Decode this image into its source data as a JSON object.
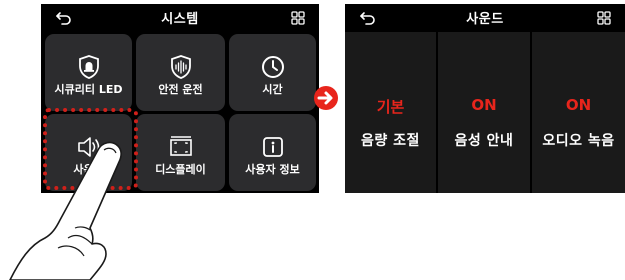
{
  "left_screen": {
    "title": "시스템",
    "tiles": [
      {
        "label": "시큐리티 LED",
        "icon": "security-led-icon"
      },
      {
        "label": "안전 운전",
        "icon": "safe-driving-icon"
      },
      {
        "label": "시간",
        "icon": "clock-icon"
      },
      {
        "label": "사운드",
        "icon": "speaker-icon"
      },
      {
        "label": "디스플레이",
        "icon": "display-icon"
      },
      {
        "label": "사용자 정보",
        "icon": "info-icon"
      }
    ]
  },
  "right_screen": {
    "title": "사운드",
    "panels": [
      {
        "value": "기본",
        "caption": "음량 조절"
      },
      {
        "value": "ON",
        "caption": "음성 안내"
      },
      {
        "value": "ON",
        "caption": "오디오 녹음"
      }
    ]
  },
  "colors": {
    "accent": "#e8251c",
    "highlight": "#d0201a",
    "tile_bg": "#2c2c2e",
    "screen_bg": "#000000"
  }
}
